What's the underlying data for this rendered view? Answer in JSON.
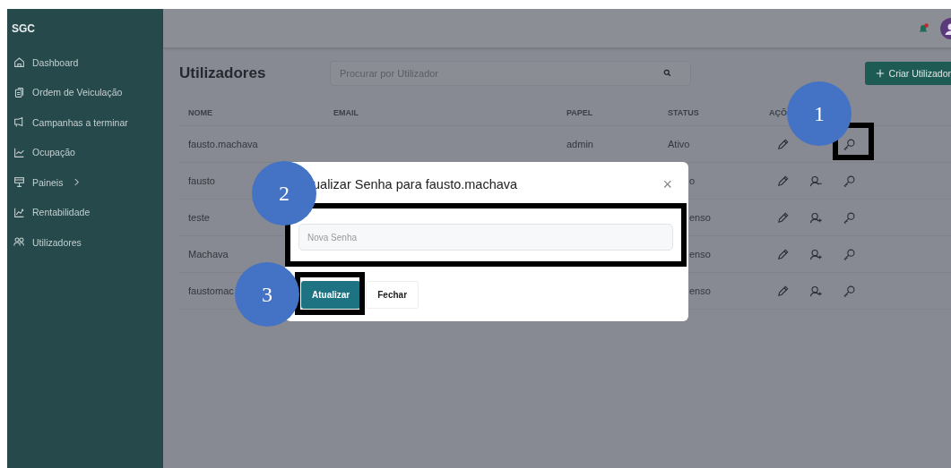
{
  "app": {
    "title": "SGC"
  },
  "sidebar": {
    "items": [
      {
        "label": "Dashboard",
        "submenu": false
      },
      {
        "label": "Ordem de Veiculação",
        "submenu": false
      },
      {
        "label": "Campanhas a terminar",
        "submenu": false
      },
      {
        "label": "Ocupação",
        "submenu": false
      },
      {
        "label": "Paineis",
        "submenu": true
      },
      {
        "label": "Rentabilidade",
        "submenu": false
      },
      {
        "label": "Utilizadores",
        "submenu": false
      }
    ]
  },
  "header": {
    "notification": {
      "unread": true
    }
  },
  "page": {
    "title": "Utilizadores",
    "search": {
      "placeholder": "Procurar por Utilizador"
    },
    "create_button": {
      "label": "Criar Utilizador"
    }
  },
  "table": {
    "columns": [
      "NOME",
      "EMAIL",
      "PAPEL",
      "STATUS",
      "AÇÕ"
    ],
    "rows": [
      {
        "name": "fausto.machava",
        "role": "admin",
        "status": "Ativo"
      },
      {
        "name": "fausto",
        "status": "o",
        "kind": "deactivate"
      },
      {
        "name": "teste",
        "status": "enso",
        "kind": "activate"
      },
      {
        "name": "Machava",
        "status": "enso",
        "kind": "activate"
      },
      {
        "name": "faustomac",
        "status": "enso",
        "kind": "activate"
      }
    ]
  },
  "modal": {
    "title": "ualizar Senha para fausto.machava",
    "close": "×",
    "input": {
      "placeholder": "Nova Senha"
    },
    "buttons": [
      {
        "label": "Atualizar",
        "kind": "primary"
      },
      {
        "label": "Fechar",
        "kind": "secondary"
      }
    ]
  },
  "callouts": [
    {
      "number": "1"
    },
    {
      "number": "2"
    },
    {
      "number": "3"
    }
  ]
}
